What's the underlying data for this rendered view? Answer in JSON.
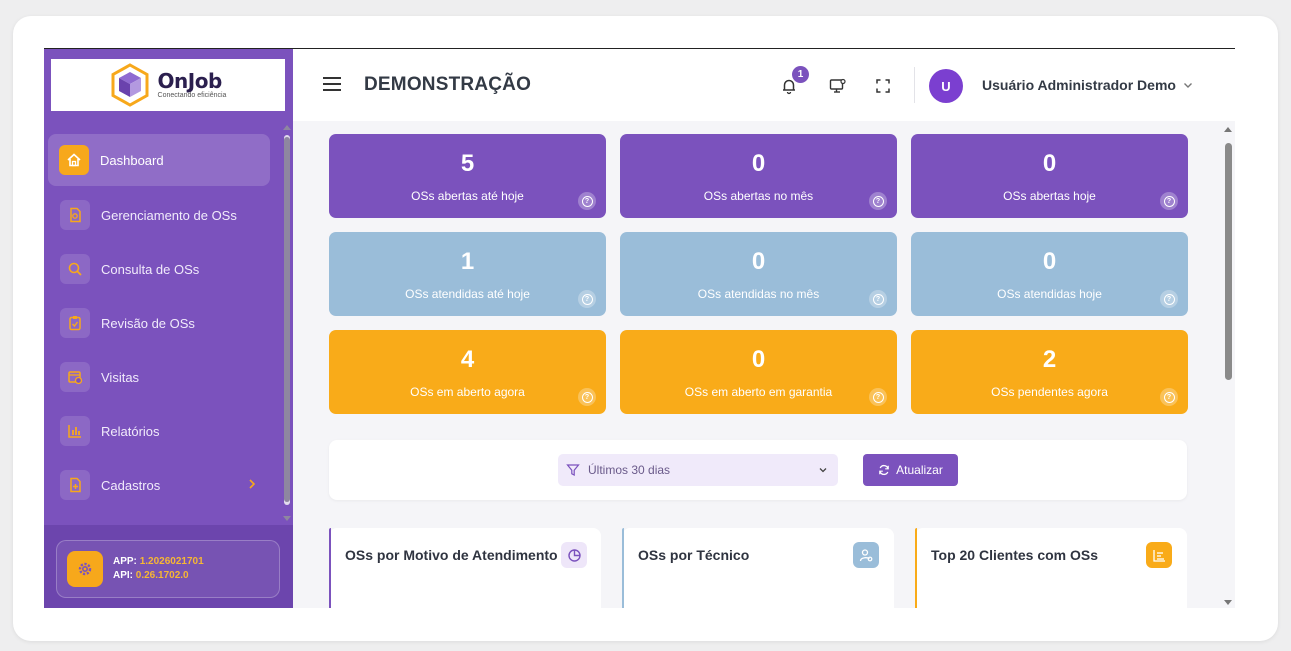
{
  "brand": {
    "name": "OnJob",
    "tagline": "Conectando eficiência"
  },
  "sidebar": {
    "items": [
      {
        "label": "Dashboard",
        "icon": "home-icon",
        "active": true
      },
      {
        "label": "Gerenciamento de OSs",
        "icon": "document-icon"
      },
      {
        "label": "Consulta de OSs",
        "icon": "search-icon"
      },
      {
        "label": "Revisão de OSs",
        "icon": "clipboard-icon"
      },
      {
        "label": "Visitas",
        "icon": "calendar-clock-icon"
      },
      {
        "label": "Relatórios",
        "icon": "bar-chart-icon"
      },
      {
        "label": "Cadastros",
        "icon": "add-file-icon",
        "has_submenu": true
      }
    ],
    "version": {
      "app_label": "APP:",
      "app_value": "1.2026021701",
      "api_label": "API:",
      "api_value": "0.26.1702.0"
    }
  },
  "header": {
    "title": "DEMONSTRAÇÃO",
    "notification_count": "1",
    "avatar_initial": "U",
    "user_name": "Usuário Administrador Demo"
  },
  "stats": [
    {
      "value": "5",
      "label": "OSs abertas até hoje",
      "color": "purple"
    },
    {
      "value": "0",
      "label": "OSs abertas no mês",
      "color": "purple"
    },
    {
      "value": "0",
      "label": "OSs abertas hoje",
      "color": "purple"
    },
    {
      "value": "1",
      "label": "OSs atendidas até hoje",
      "color": "blue"
    },
    {
      "value": "0",
      "label": "OSs atendidas no mês",
      "color": "blue"
    },
    {
      "value": "0",
      "label": "OSs atendidas hoje",
      "color": "blue"
    },
    {
      "value": "4",
      "label": "OSs em aberto agora",
      "color": "orange"
    },
    {
      "value": "0",
      "label": "OSs em aberto em garantia",
      "color": "orange"
    },
    {
      "value": "2",
      "label": "OSs pendentes agora",
      "color": "orange"
    }
  ],
  "filter": {
    "period_value": "Últimos 30 dias",
    "update_label": "Atualizar"
  },
  "panels": [
    {
      "title": "OSs por Motivo de Atendimento",
      "icon": "pie-chart-icon"
    },
    {
      "title": "OSs por Técnico",
      "icon": "user-search-icon"
    },
    {
      "title": "Top 20 Clientes com OSs",
      "icon": "bar-chart-icon"
    }
  ],
  "colors": {
    "primary": "#7b52bd",
    "accent": "#f9ab19",
    "info": "#9abdd9"
  }
}
